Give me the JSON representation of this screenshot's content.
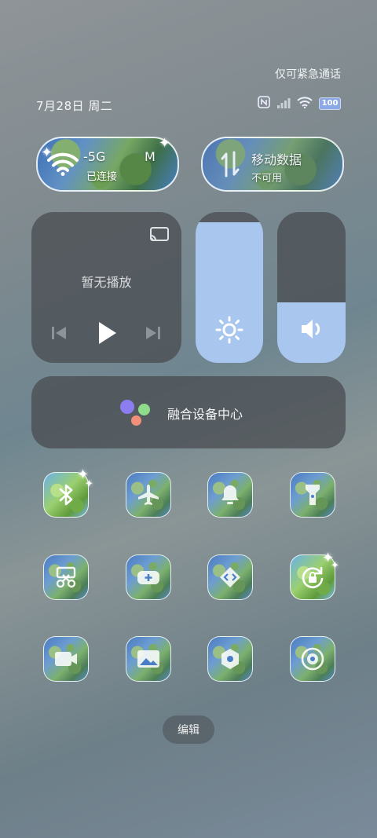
{
  "status_bar": {
    "emergency_text": "仅可紧急通话",
    "date": "7月28日 周二",
    "battery": "100",
    "icons": [
      "nfc-icon",
      "signal-icon",
      "wifi-icon",
      "battery-icon"
    ]
  },
  "wifi_tile": {
    "network": "-5G",
    "network_suffix": "M",
    "status": "已连接"
  },
  "mobile_data_tile": {
    "title": "移动数据",
    "status": "不可用"
  },
  "media": {
    "status": "暂无播放",
    "icons": [
      "cast-icon",
      "previous-icon",
      "play-icon",
      "next-icon"
    ]
  },
  "sliders": {
    "brightness_level": 0.93,
    "volume_level": 0.4
  },
  "device_center": {
    "label": "融合设备中心"
  },
  "toggles": [
    {
      "name": "bluetooth",
      "icon": "bluetooth-icon",
      "active": true
    },
    {
      "name": "airplane-mode",
      "icon": "airplane-icon",
      "active": false
    },
    {
      "name": "silent-mode",
      "icon": "bell-icon",
      "active": false
    },
    {
      "name": "flashlight",
      "icon": "flashlight-icon",
      "active": false
    },
    {
      "name": "screenshot",
      "icon": "scissors-icon",
      "active": false
    },
    {
      "name": "game-mode",
      "icon": "gamepad-icon",
      "active": false
    },
    {
      "name": "shortcut",
      "icon": "code-icon",
      "active": false
    },
    {
      "name": "rotation-lock",
      "icon": "rotation-lock-icon",
      "active": true
    },
    {
      "name": "screen-record",
      "icon": "video-icon",
      "active": false
    },
    {
      "name": "gallery",
      "icon": "image-icon",
      "active": false
    },
    {
      "name": "settings",
      "icon": "gear-icon",
      "active": false
    },
    {
      "name": "dark-mode",
      "icon": "eye-icon",
      "active": false
    }
  ],
  "edit": {
    "label": "编辑"
  },
  "colors": {
    "accent": "#a9c6ef",
    "card": "#464a4e"
  }
}
